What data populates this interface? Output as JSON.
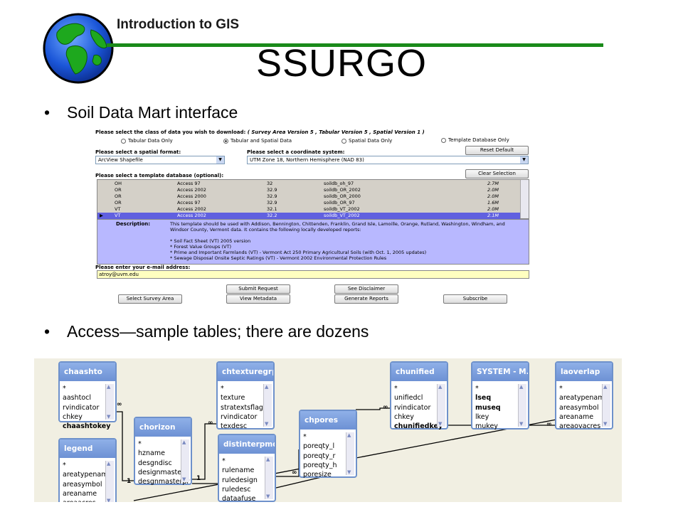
{
  "header": {
    "label": "Introduction to GIS",
    "title": "SSURGO"
  },
  "bullets": [
    "Soil Data Mart interface",
    "Access—sample tables; there are dozens"
  ],
  "soil_data_mart": {
    "class_prompt": "Please select the class of data you wish to download:",
    "class_versions": "( Survey Area Version 5 , Tabular Version 5 , Spatial Version 1 )",
    "radio_options": [
      "Tabular Data Only",
      "Tabular and Spatial Data",
      "Spatial Data Only",
      "Template Database Only"
    ],
    "radio_selected": "Tabular and Spatial Data",
    "spatial_format_prompt": "Please select a spatial format:",
    "spatial_format_value": "ArcView Shapefile",
    "coord_prompt": "Please select a coordinate system:",
    "coord_value": "UTM Zone 18, Northern Hemisphere (NAD 83)",
    "reset_default_label": "Reset Default",
    "template_prompt": "Please select a template database (optional):",
    "clear_selection_label": "Clear Selection",
    "template_rows": [
      [
        "OH",
        "Access 97",
        "32",
        "soildb_oh_97",
        "2.7M"
      ],
      [
        "OR",
        "Access 2002",
        "32.9",
        "soildb_OR_2002",
        "2.0M"
      ],
      [
        "OR",
        "Access 2000",
        "32.9",
        "soildb_OR_2000",
        "2.0M"
      ],
      [
        "OR",
        "Access 97",
        "32.9",
        "soildb_OR_97",
        "1.6M"
      ],
      [
        "VT",
        "Access 2002",
        "32.1",
        "soildb_VT_2002",
        "2.0M"
      ],
      [
        "VT",
        "Access 2002",
        "32.2",
        "soildb_VT_2002",
        "2.1M"
      ]
    ],
    "description_label": "Description:",
    "description_text": "This template should be used with Addison, Bennington, Chittenden, Franklin, Grand Isle, Lamoille, Orange, Rutland, Washington, Windham, and Windsor County, Vermont data. It contains the following locally developed reports:",
    "description_items": [
      "* Soil Fact Sheet (VT) 2005 version",
      "* Forest Value Groups (VT)",
      "* Prime and Important Farmlands (VT) - Vermont Act 250 Primary Agricultural Soils (with Oct. 1, 2005 updates)",
      "* Sewage Disposal Onsite Septic Ratings (VT) - Vermont 2002 Environmental Protection Rules"
    ],
    "email_prompt": "Please enter your e-mail address:",
    "email_value": "atroy@uvm.edu",
    "buttons": {
      "submit_request": "Submit Request",
      "see_disclaimer": "See Disclaimer",
      "select_survey_area": "Select Survey Area",
      "view_metadata": "View Metadata",
      "generate_reports": "Generate Reports",
      "subscribe": "Subscribe"
    }
  },
  "access_tables": [
    {
      "title": "chaashto",
      "fields": [
        "*",
        "aashtocl",
        "rvindicator",
        "chkey",
        "chaashtokey"
      ],
      "bold": [
        "chaashtokey"
      ]
    },
    {
      "title": "chorizon",
      "fields": [
        "*",
        "hzname",
        "desgndisc",
        "designmaster",
        "desgnmasterpr"
      ],
      "bold": []
    },
    {
      "title": "legend",
      "fields": [
        "*",
        "areatypename",
        "areasymbol",
        "areaname",
        "areaacres"
      ],
      "bold": []
    },
    {
      "title": "chtexturegrp",
      "fields": [
        "*",
        "texture",
        "stratextsflag",
        "rvindicator",
        "texdesc"
      ],
      "bold": []
    },
    {
      "title": "distinterpmd",
      "fields": [
        "*",
        "rulename",
        "ruledesign",
        "ruledesc",
        "dataafuse"
      ],
      "bold": []
    },
    {
      "title": "chpores",
      "fields": [
        "*",
        "poreqty_l",
        "poreqty_r",
        "poreqty_h",
        "poresize"
      ],
      "bold": []
    },
    {
      "title": "chunified",
      "fields": [
        "*",
        "unifiedcl",
        "rvindicator",
        "chkey",
        "chunifiedkey"
      ],
      "bold": [
        "chunifiedkey"
      ]
    },
    {
      "title": "SYSTEM - M...",
      "fields": [
        "*",
        "lseq",
        "museq",
        "lkey",
        "mukey"
      ],
      "bold": [
        "lseq",
        "museq"
      ]
    },
    {
      "title": "laoverlap",
      "fields": [
        "*",
        "areatypename",
        "areasymbol",
        "areaname",
        "areaovacres"
      ],
      "bold": []
    }
  ],
  "relationship_marks": {
    "infinity": "∞",
    "one": "1"
  }
}
